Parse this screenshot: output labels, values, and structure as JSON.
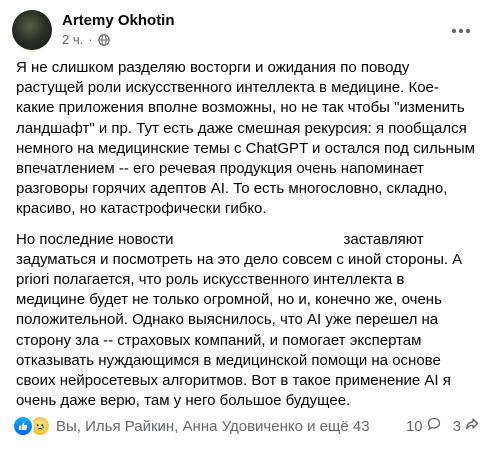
{
  "post": {
    "author": "Artemy Okhotin",
    "time": "2 ч.",
    "dot": "·",
    "paragraphs": [
      "Я не слишком разделяю восторги и ожидания по поводу растущей роли искусственного интеллекта в медицине. Кое-какие приложения вполне возможны, но не так чтобы \"изменить ландшафт\" и пр. Тут есть даже смешная рекурсия: я пообщался немного на медицинские темы с ChatGPT и остался под сильным впечатлением -- его речевая продукция очень напоминает разговоры горячих адептов AI. То есть многословно, складно, красиво, но катастрофически гибко."
    ],
    "p2_start": "Но последние новости",
    "p2_rest": "заставляют задуматься и посмотреть на это дело совсем с иной стороны. A priori полагается, что роль искусственного интеллекта в медицине будет не только огромной, но и, конечно же, очень положительной. Однако выяснилось, что AI уже перешел на сторону зла -- страховых компаний, и помогает экспертам отказывать нуждающимся в медицинской помощи на основе своих нейросетевых алгоритмов. Вот в такое применение AI я очень даже верю, там у него большое будущее."
  },
  "footer": {
    "reactions_text": "Вы, Илья Райкин, Анна Удовиченко и ещё 43",
    "comments_count": "10",
    "shares_count": "3"
  },
  "icons": {
    "globe": "globe-icon",
    "more": "more-icon",
    "like": "like-reaction-icon",
    "sad": "sad-reaction-icon",
    "comment": "comment-icon",
    "share": "share-icon"
  }
}
